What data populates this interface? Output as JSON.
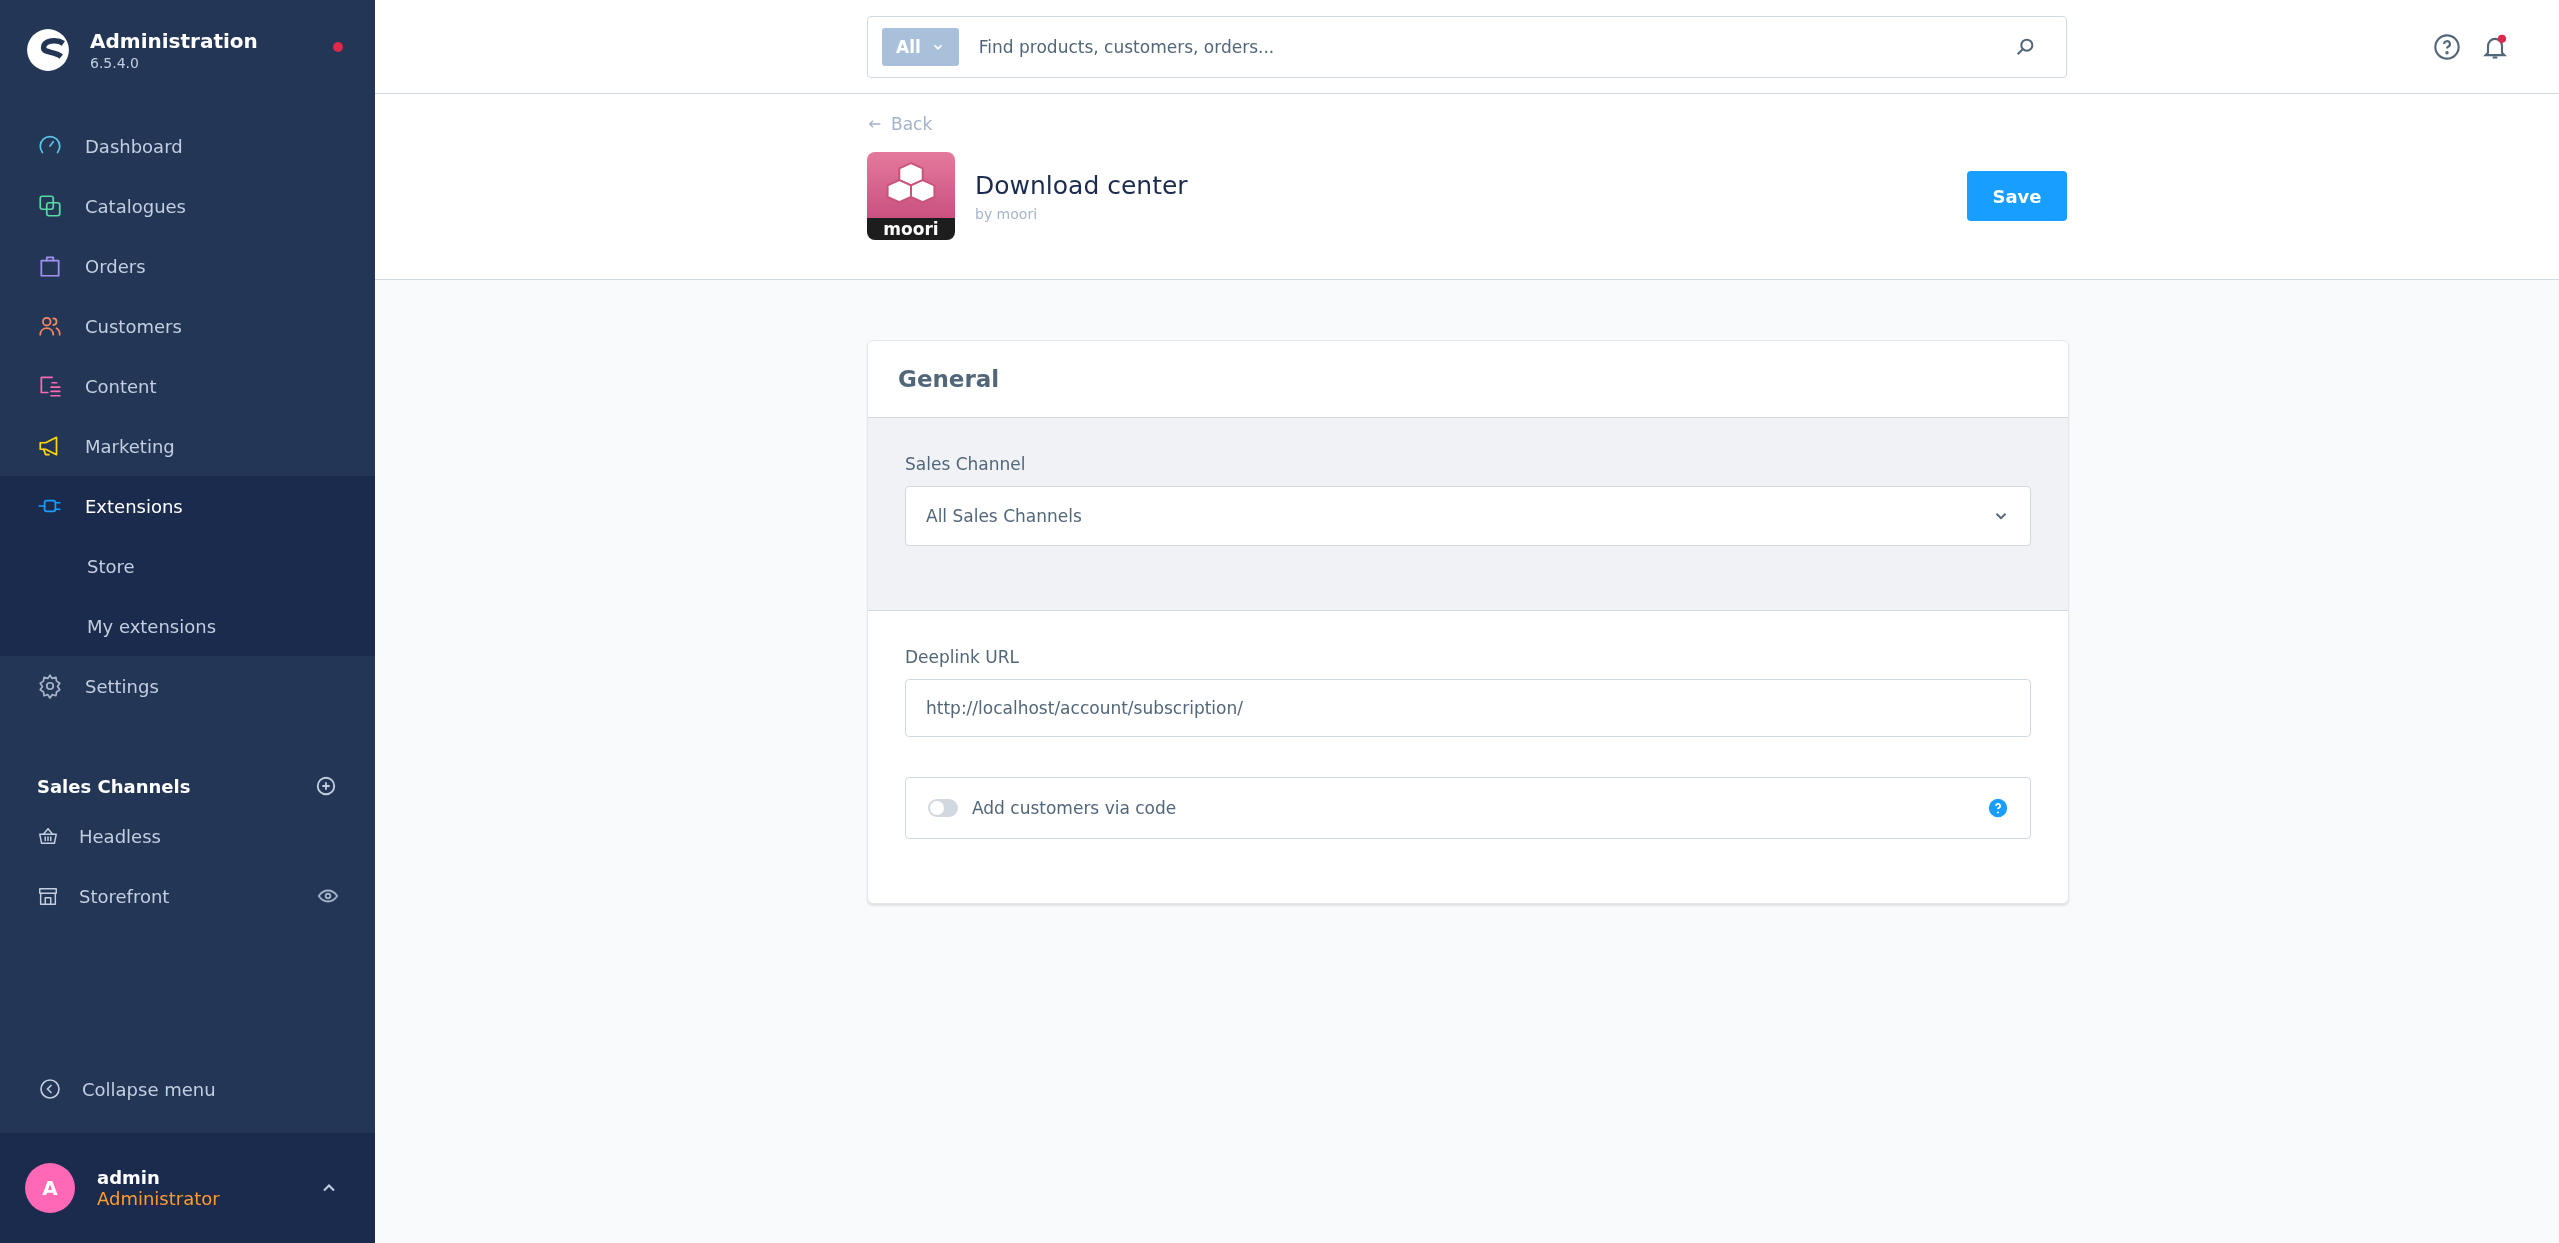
{
  "brand": {
    "title": "Administration",
    "version": "6.5.4.0",
    "notification": true
  },
  "nav": [
    {
      "label": "Dashboard",
      "kind": "dashboard",
      "color": "#5bc3e8",
      "selected": false
    },
    {
      "label": "Catalogues",
      "kind": "catalogue",
      "color": "#57d9a3",
      "selected": false
    },
    {
      "label": "Orders",
      "kind": "orders",
      "color": "#a092f0",
      "selected": false
    },
    {
      "label": "Customers",
      "kind": "customers",
      "color": "#f88962",
      "selected": false
    },
    {
      "label": "Content",
      "kind": "content",
      "color": "#ff68b4",
      "selected": false
    },
    {
      "label": "Marketing",
      "kind": "marketing",
      "color": "#ffd700",
      "selected": false
    },
    {
      "label": "Extensions",
      "kind": "extensions",
      "color": "#189eff",
      "selected": true,
      "children": [
        {
          "label": "Store"
        },
        {
          "label": "My extensions"
        }
      ]
    },
    {
      "label": "Settings",
      "kind": "settings",
      "color": "#a5b3c8",
      "selected": false
    }
  ],
  "sales_channels": {
    "title": "Sales Channels",
    "items": [
      {
        "label": "Headless",
        "kind": "basket",
        "preview": false
      },
      {
        "label": "Storefront",
        "kind": "store",
        "preview": true
      }
    ]
  },
  "collapse": "Collapse menu",
  "user": {
    "initial": "A",
    "name": "admin",
    "role": "Administrator"
  },
  "search": {
    "scope": "All",
    "placeholder": "Find products, customers, orders..."
  },
  "top_icons": {
    "notifications": true
  },
  "page": {
    "back": "Back",
    "logo_text": "moori",
    "title": "Download center",
    "author": "by moori",
    "save": "Save"
  },
  "card": {
    "title": "General",
    "sales_channel": {
      "label": "Sales Channel",
      "value": "All Sales Channels"
    },
    "deeplink": {
      "label": "Deeplink URL",
      "value": "http://localhost/account/subscription/"
    },
    "toggle": {
      "label": "Add customers via code",
      "on": false
    }
  }
}
